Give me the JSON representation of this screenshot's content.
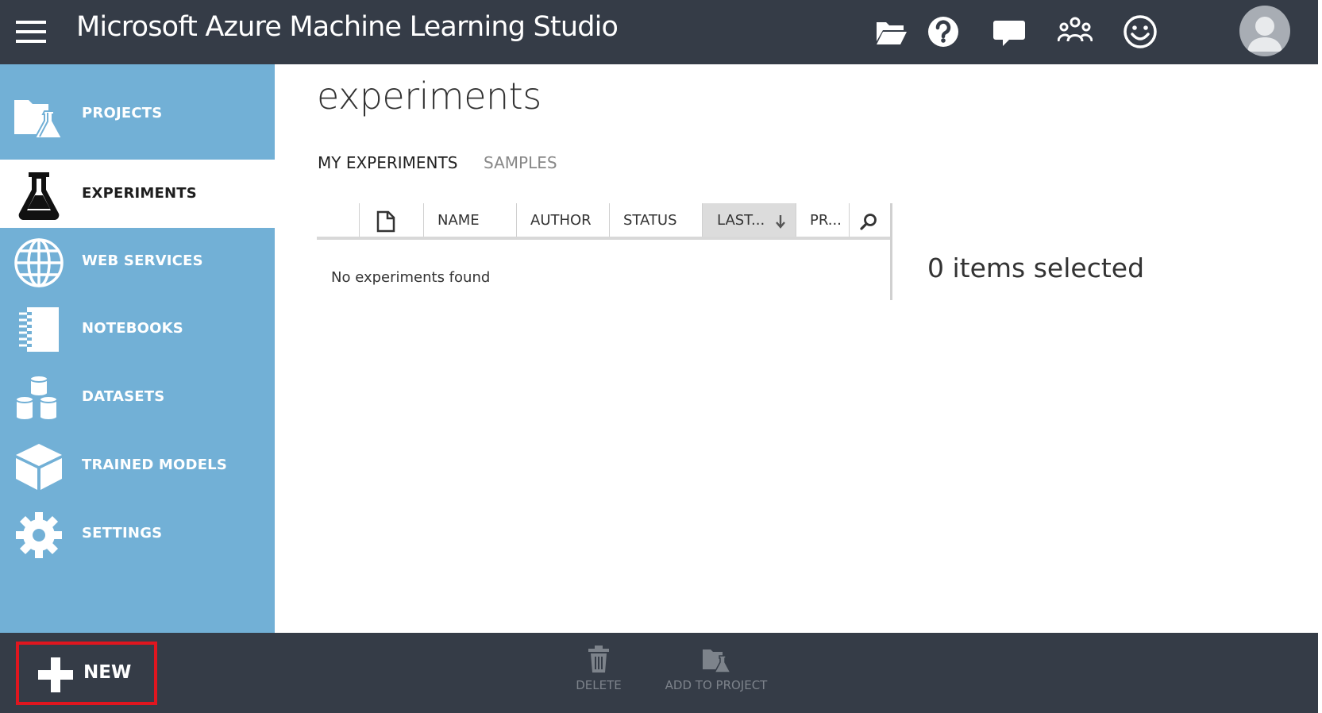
{
  "header": {
    "app_title": "Microsoft Azure Machine Learning Studio",
    "icons": [
      "menu-icon",
      "folder-open-icon",
      "help-icon",
      "feedback-icon",
      "community-icon",
      "smiley-icon",
      "avatar"
    ]
  },
  "sidebar": {
    "items": [
      {
        "label": "PROJECTS",
        "icon": "projects-icon",
        "active": false
      },
      {
        "label": "EXPERIMENTS",
        "icon": "flask-icon",
        "active": true
      },
      {
        "label": "WEB SERVICES",
        "icon": "globe-icon",
        "active": false
      },
      {
        "label": "NOTEBOOKS",
        "icon": "notebook-icon",
        "active": false
      },
      {
        "label": "DATASETS",
        "icon": "datasets-icon",
        "active": false
      },
      {
        "label": "TRAINED MODELS",
        "icon": "cube-icon",
        "active": false
      },
      {
        "label": "SETTINGS",
        "icon": "gear-icon",
        "active": false
      }
    ]
  },
  "main": {
    "page_title": "experiments",
    "tabs": [
      {
        "label": "MY EXPERIMENTS",
        "active": true
      },
      {
        "label": "SAMPLES",
        "active": false
      }
    ],
    "table": {
      "columns": [
        "NAME",
        "AUTHOR",
        "STATUS",
        "LAST...",
        "PR..."
      ],
      "sorted_column": "LAST...",
      "empty_message": "No experiments found"
    },
    "selection_text": "0 items selected"
  },
  "bottom_bar": {
    "new_label": "NEW",
    "actions": [
      {
        "label": "DELETE",
        "icon": "trash-icon"
      },
      {
        "label": "ADD TO PROJECT",
        "icon": "add-to-project-icon"
      }
    ]
  },
  "colors": {
    "topbar_bg": "#353c47",
    "sidebar_bg": "#72b0d6",
    "highlight_border": "#e0161f"
  }
}
